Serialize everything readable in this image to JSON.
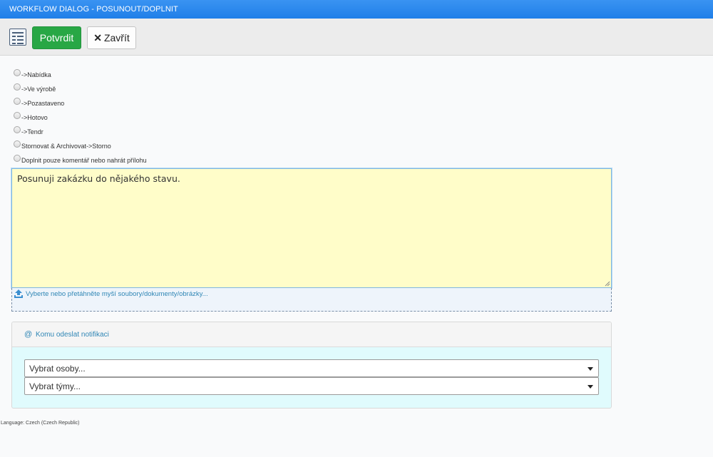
{
  "window": {
    "title": "WORKFLOW DIALOG - POSUNOUT/DOPLNIT"
  },
  "toolbar": {
    "list_icon": "list-form-icon",
    "confirm_label": "Potvrdit",
    "close_label": "Zavřít",
    "close_icon": "close-icon"
  },
  "options": [
    {
      "label": "->Nabídka"
    },
    {
      "label": "->Ve výrobě"
    },
    {
      "label": "->Pozastaveno"
    },
    {
      "label": "->Hotovo"
    },
    {
      "label": "->Tendr"
    },
    {
      "label": "Stornovat & Archivovat->Storno"
    },
    {
      "label": "Doplnit pouze komentář nebo nahrát přílohu"
    }
  ],
  "comment": {
    "value": "Posunuji zakázku do nějakého stavu."
  },
  "upload": {
    "icon": "upload-icon",
    "label": "Vyberte nebo přetáhněte myší soubory/dokumenty/obrázky..."
  },
  "notifications": {
    "header_icon": "at-icon",
    "header_label": "Komu odeslat notifikaci",
    "persons_placeholder": "Vybrat osoby...",
    "teams_placeholder": "Vybrat týmy..."
  },
  "footer": {
    "language": "Language: Czech (Czech Republic)"
  },
  "colors": {
    "titlebar": "#1f7fe8",
    "confirm_button": "#28a745",
    "comment_background": "#fffdc9",
    "link": "#2f86b5",
    "notification_body": "#e0fbfd"
  }
}
